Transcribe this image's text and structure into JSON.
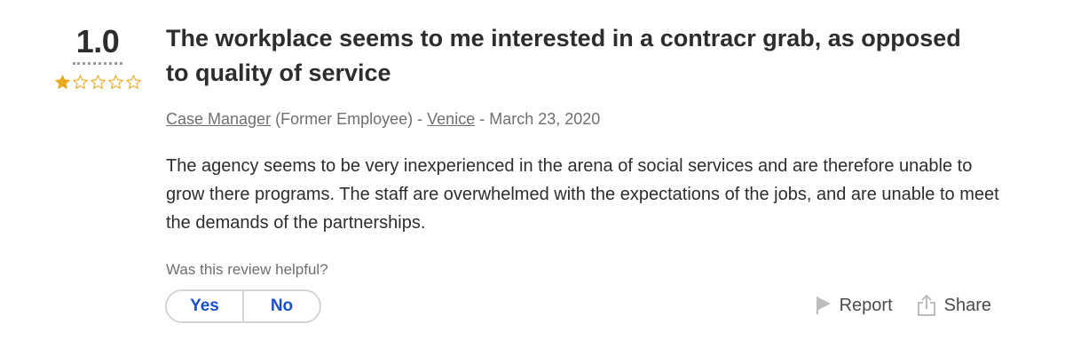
{
  "review": {
    "rating": "1.0",
    "stars": {
      "filled": 1,
      "total": 5,
      "color": "#e8a91f"
    },
    "title": "The workplace seems to me interested in a contracr grab, as opposed to quality of service",
    "job_title": "Case Manager",
    "employee_status": "(Former Employee)",
    "separator1": "-",
    "location": "Venice",
    "separator2": "-",
    "date": "March 23, 2020",
    "body": "The agency seems to be very inexperienced in the arena of social services and are therefore unable to grow there programs. The staff are overwhelmed with the expectations of the jobs, and are unable to meet the demands of the partnerships."
  },
  "feedback": {
    "question": "Was this review helpful?",
    "yes_label": "Yes",
    "no_label": "No",
    "accent_color": "#1a4fcf"
  },
  "actions": {
    "report_label": "Report",
    "report_icon": "flag-icon",
    "share_label": "Share",
    "share_icon": "share-icon"
  }
}
